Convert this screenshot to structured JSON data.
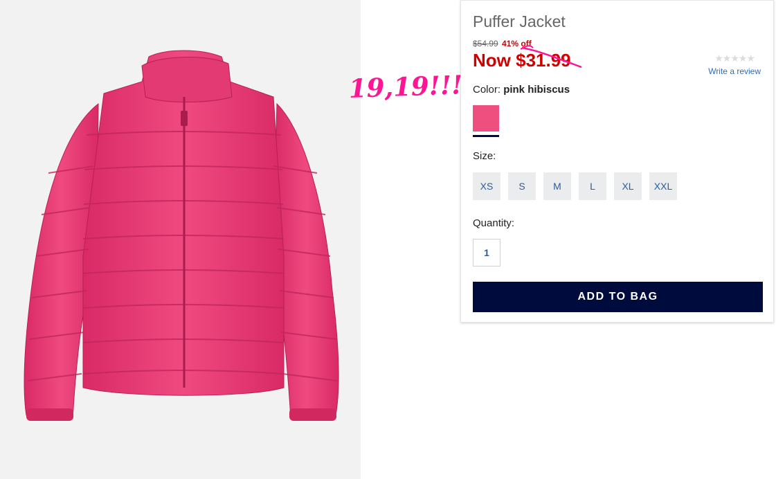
{
  "product": {
    "title": "Puffer Jacket",
    "old_price": "$54.99",
    "discount": "41% off",
    "now_price": "Now $31.99",
    "rating_stars": "★★★★★",
    "review_link": "Write a review",
    "color_label": "Color:",
    "color_value": "pink hibiscus",
    "swatch_color": "#ef4f7e",
    "size_label": "Size:",
    "sizes": [
      "XS",
      "S",
      "M",
      "L",
      "XL",
      "XXL"
    ],
    "quantity_label": "Quantity:",
    "quantity_value": "1",
    "add_button": "ADD TO BAG"
  },
  "annotation": {
    "text": "19,19!!!",
    "color": "#ff1493"
  },
  "colors": {
    "brand_navy": "#000b3d",
    "sale_red": "#d00000",
    "link_blue": "#2a6ebb",
    "jacket_pink": "#ec3f78"
  }
}
